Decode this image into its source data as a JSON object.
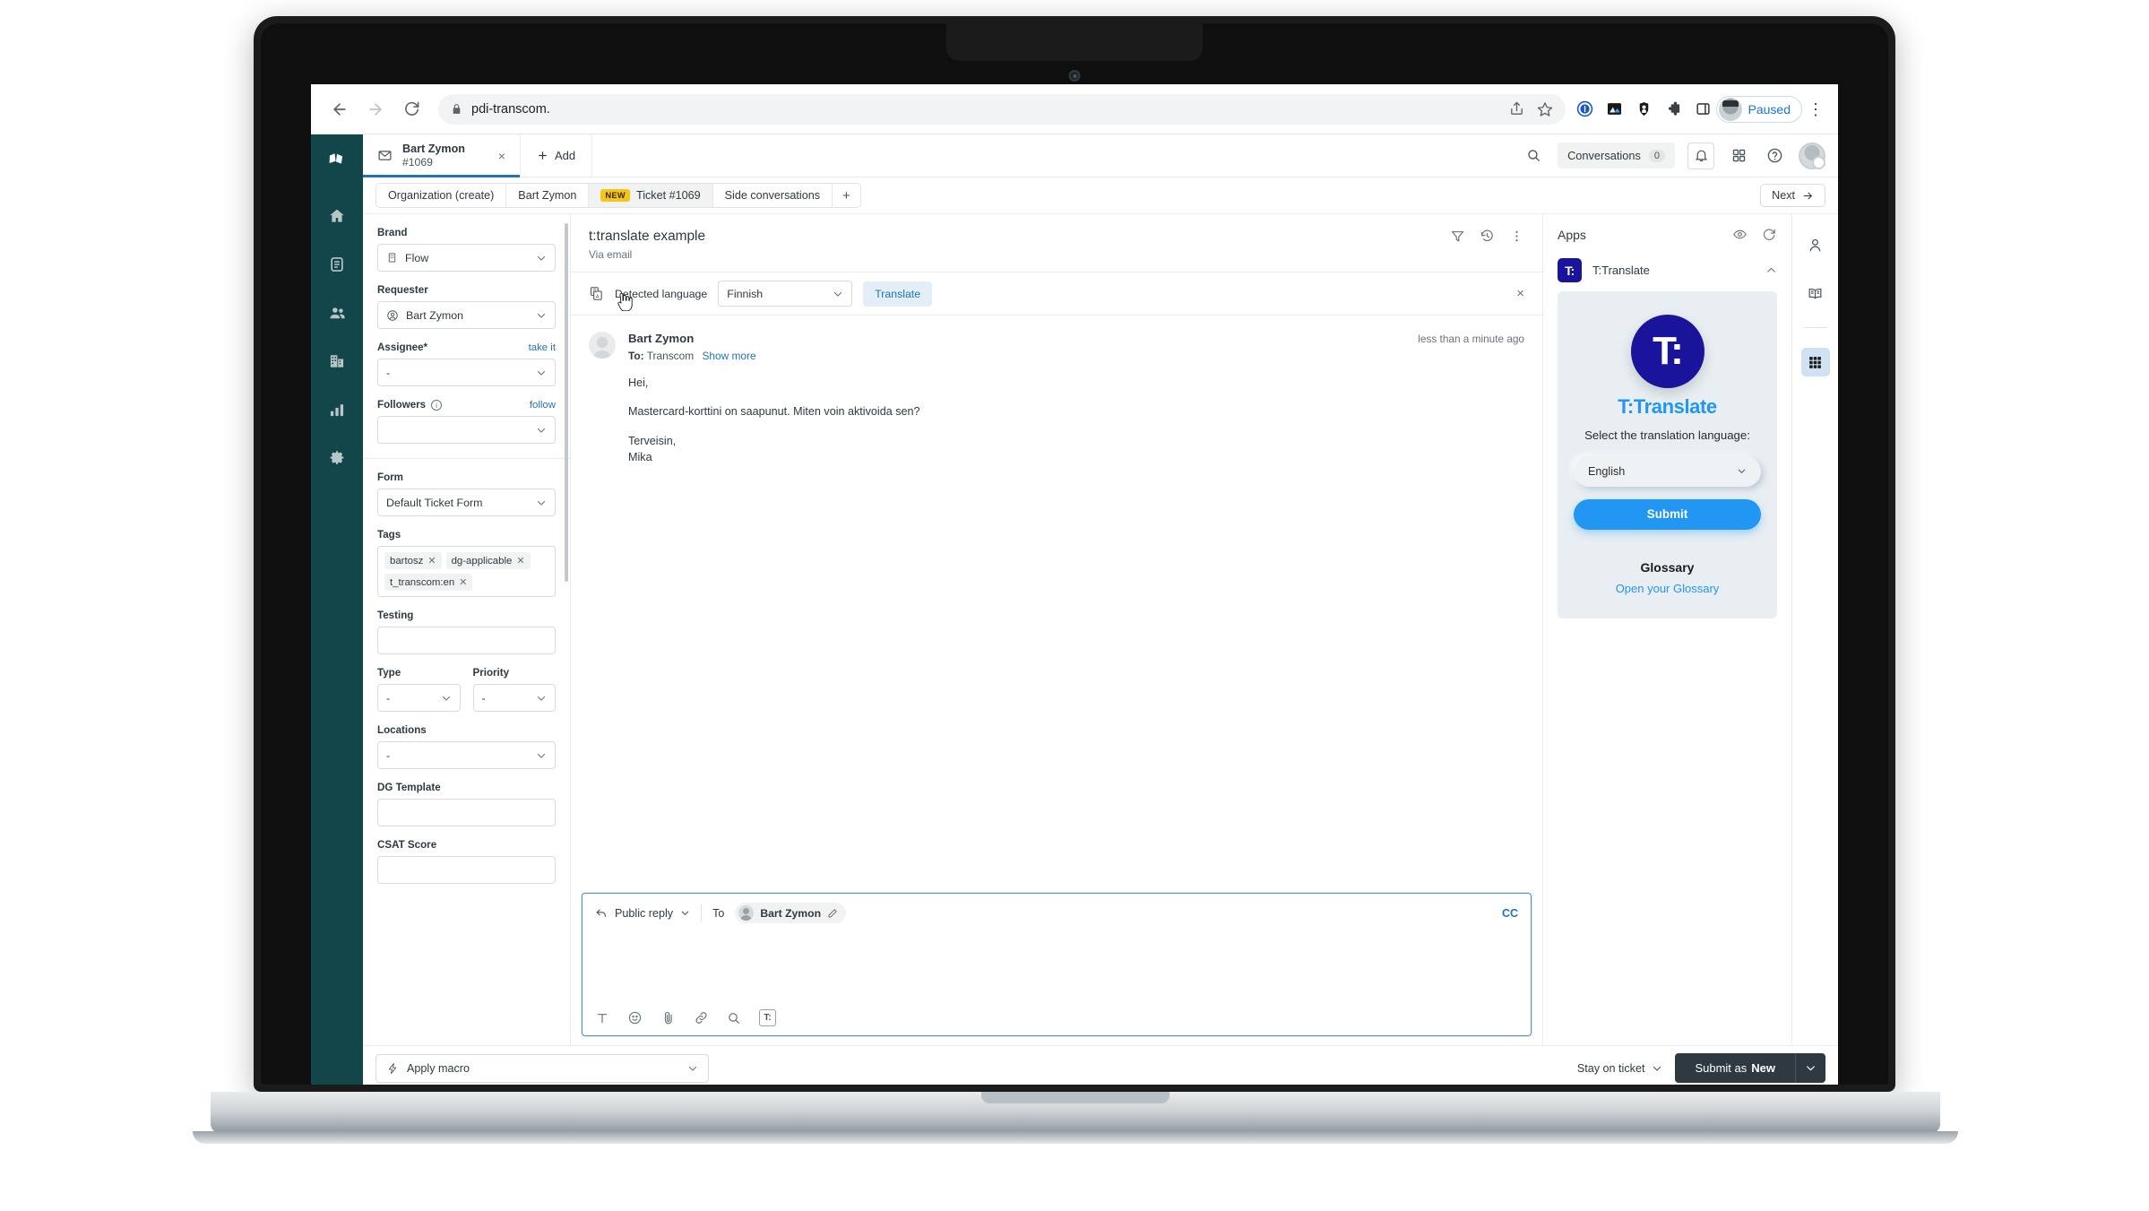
{
  "browser": {
    "url": "pdi-transcom.",
    "back_label": "Back",
    "forward_label": "Forward",
    "reload_label": "Reload",
    "profile_label": "Paused",
    "extensions": [
      "1password-icon",
      "image-extension-icon",
      "shield-extension-icon",
      "puzzle-icon",
      "sidepanel-icon"
    ]
  },
  "rail": {
    "logo": "zendesk-logo",
    "items": [
      {
        "name": "home-icon",
        "label": "Home"
      },
      {
        "name": "views-icon",
        "label": "Views"
      },
      {
        "name": "customers-icon",
        "label": "Customers"
      },
      {
        "name": "organizations-icon",
        "label": "Organizations"
      },
      {
        "name": "reporting-icon",
        "label": "Reporting"
      },
      {
        "name": "settings-icon",
        "label": "Admin"
      }
    ]
  },
  "header": {
    "tab": {
      "title": "Bart Zymon",
      "subtitle": "#1069",
      "close": "×"
    },
    "add_label": "Add",
    "conversations_label": "Conversations",
    "conversations_count": "0",
    "search_icon": "search-icon",
    "bell_icon": "bell-icon",
    "grid_icon": "apps-grid-icon",
    "help_icon": "help-icon"
  },
  "crumbs": {
    "items": [
      {
        "label": "Organization (create)",
        "selected": false,
        "badge": ""
      },
      {
        "label": "Bart Zymon",
        "selected": false,
        "badge": ""
      },
      {
        "label": "Ticket #1069",
        "selected": true,
        "badge": "NEW"
      },
      {
        "label": "Side conversations",
        "selected": false,
        "badge": ""
      }
    ],
    "plus": "+",
    "next_label": "Next"
  },
  "sidebar": {
    "brand": {
      "label": "Brand",
      "value": "Flow",
      "icon": "building-icon"
    },
    "requester": {
      "label": "Requester",
      "value": "Bart Zymon",
      "icon": "user-circle-icon"
    },
    "assignee": {
      "label": "Assignee*",
      "action": "take it",
      "value": "-"
    },
    "followers": {
      "label": "Followers",
      "action": "follow",
      "value": ""
    },
    "form": {
      "label": "Form",
      "value": "Default Ticket Form"
    },
    "tags": {
      "label": "Tags",
      "values": [
        "bartosz",
        "dg-applicable",
        "t_transcom:en"
      ]
    },
    "testing": {
      "label": "Testing",
      "value": ""
    },
    "type": {
      "label": "Type",
      "value": "-"
    },
    "priority": {
      "label": "Priority",
      "value": "-"
    },
    "locations": {
      "label": "Locations",
      "value": "-"
    },
    "dg_template": {
      "label": "DG Template",
      "value": ""
    },
    "csat": {
      "label": "CSAT Score",
      "value": ""
    }
  },
  "ticket": {
    "title": "t:translate example",
    "subtitle": "Via email",
    "icons": [
      "filter-icon",
      "history-icon",
      "more-vertical-icon"
    ],
    "translate_bar": {
      "icon": "translate-icon",
      "label": "Detected language",
      "language": "Finnish",
      "button": "Translate",
      "close": "×"
    },
    "comment": {
      "author": "Bart Zymon",
      "time": "less than a minute ago",
      "to_label": "To:",
      "to_value": "Transcom",
      "show_more": "Show more",
      "lines": [
        "Hei,",
        "Mastercard-korttini on saapunut. Miten voin aktivoida sen?",
        "Terveisin,\nMika"
      ]
    }
  },
  "composer": {
    "reply_type": "Public reply",
    "to_label": "To",
    "recipient": "Bart Zymon",
    "cc_label": "CC",
    "tools": [
      "text-format-icon",
      "emoji-icon",
      "attachment-icon",
      "link-icon",
      "search-icon",
      "ttranslate-icon"
    ],
    "placeholder": ""
  },
  "apps": {
    "title": "Apps",
    "eye_icon": "eye-icon",
    "refresh_icon": "refresh-icon",
    "item": {
      "name": "T:Translate",
      "logo_text": "T:",
      "collapse_icon": "chevron-up-icon"
    },
    "card": {
      "logo_text": "T:",
      "brand": "T:Translate",
      "prompt": "Select the translation language:",
      "language": "English",
      "submit": "Submit",
      "glossary_title": "Glossary",
      "glossary_link": "Open your Glossary"
    }
  },
  "right_rail": {
    "items": [
      {
        "name": "user-icon",
        "active": false
      },
      {
        "name": "knowledge-book-icon",
        "active": false
      },
      {
        "name": "apps-grid-icon",
        "active": true
      }
    ]
  },
  "footer": {
    "macro_label": "Apply macro",
    "macro_icon": "lightning-icon",
    "stay_label": "Stay on ticket",
    "submit_prefix": "Submit as ",
    "submit_state": "New"
  }
}
